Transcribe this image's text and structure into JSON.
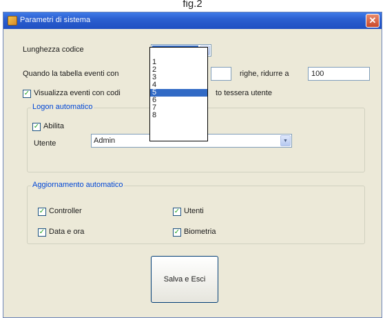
{
  "figure_caption": "fig.2",
  "window": {
    "title": "Parametri di sistema",
    "close_glyph": "✕"
  },
  "code_length": {
    "label": "Lunghezza codice",
    "selected_value": "5",
    "options": [
      "1",
      "2",
      "3",
      "4",
      "5",
      "6",
      "7",
      "8"
    ]
  },
  "events_table": {
    "label_prefix": "Quando la tabella eventi con",
    "label_mid": "righe, ridurre a",
    "reduce_to_value": "100"
  },
  "show_events": {
    "label_visible_left": "Visualizza eventi con codi",
    "label_visible_right": "to tessera utente",
    "checked": true
  },
  "logon": {
    "group_title": "Logon automatico",
    "enable_label": "Abilita",
    "enable_checked": true,
    "user_label": "Utente",
    "user_value": "Admin"
  },
  "auto_update": {
    "group_title": "Aggiornamento automatico",
    "items": [
      {
        "label": "Controller",
        "checked": true
      },
      {
        "label": "Utenti",
        "checked": true
      },
      {
        "label": "Data e ora",
        "checked": true
      },
      {
        "label": "Biometria",
        "checked": true
      }
    ]
  },
  "save_button_label": "Salva e Esci",
  "icons": {
    "app": "app-icon",
    "close": "close-icon",
    "dropdown_arrow": "chevron-down-icon",
    "check": "check-icon"
  },
  "colors": {
    "titlebar": "#2b5fd0",
    "selection": "#316ac5",
    "group_title": "#0046d5",
    "window_bg": "#ece9d8",
    "close_button": "#c9482a"
  }
}
